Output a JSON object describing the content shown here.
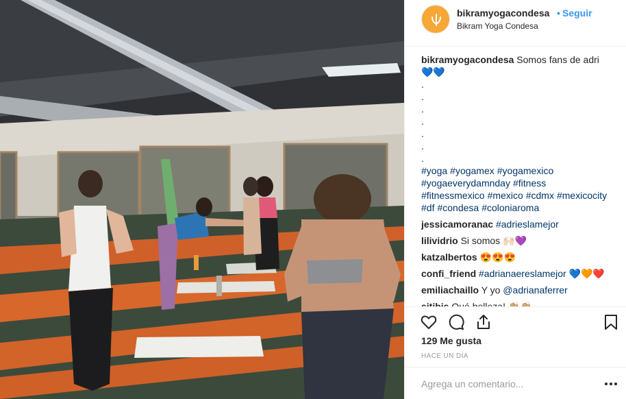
{
  "post": {
    "username": "bikramyogacondesa",
    "follow_dot": "•",
    "follow_label": "Seguir",
    "location": "Bikram Yoga Condesa",
    "caption_text": "Somos fans de adri",
    "caption_hearts": "💙💙",
    "caption_dots": [
      ".",
      ".",
      ".",
      ".",
      ".",
      ".",
      "."
    ],
    "hashtags": [
      "#yoga",
      "#yogamex",
      "#yogamexico",
      "#yogaeverydamnday",
      "#fitness",
      "#fitnessmexico",
      "#mexico",
      "#cdmx",
      "#mexicocity",
      "#df",
      "#condesa",
      "#coloniaroma"
    ]
  },
  "comments": [
    {
      "user": "jessicamoranac",
      "parts": [
        {
          "type": "link",
          "text": "#adrieslamejor"
        }
      ]
    },
    {
      "user": "lilividrio",
      "parts": [
        {
          "type": "text",
          "text": "Si somos 🙌🏻💜"
        }
      ]
    },
    {
      "user": "katzalbertos",
      "parts": [
        {
          "type": "text",
          "text": "😍😍😍"
        }
      ]
    },
    {
      "user": "confi_friend",
      "parts": [
        {
          "type": "link",
          "text": "#adrianaereslamejor"
        },
        {
          "type": "text",
          "text": " 💙🧡❤️"
        }
      ]
    },
    {
      "user": "emiliachaillo",
      "parts": [
        {
          "type": "text",
          "text": "Y yo "
        },
        {
          "type": "link",
          "text": "@adrianaferrer"
        }
      ]
    },
    {
      "user": "sitibis",
      "parts": [
        {
          "type": "text",
          "text": "Qué belleza! 👏🏼👏🏼"
        }
      ]
    }
  ],
  "actions": {
    "icons": [
      "heart-icon",
      "comment-icon",
      "share-icon",
      "bookmark-icon"
    ]
  },
  "likes_text": "129 Me gusta",
  "time_text": "HACE UN DÍA",
  "add_comment": {
    "placeholder": "Agrega un comentario..."
  },
  "colors": {
    "accent": "#3897f0",
    "hashtag": "#003569",
    "avatar": "#f7a735",
    "divider": "#efefef"
  }
}
